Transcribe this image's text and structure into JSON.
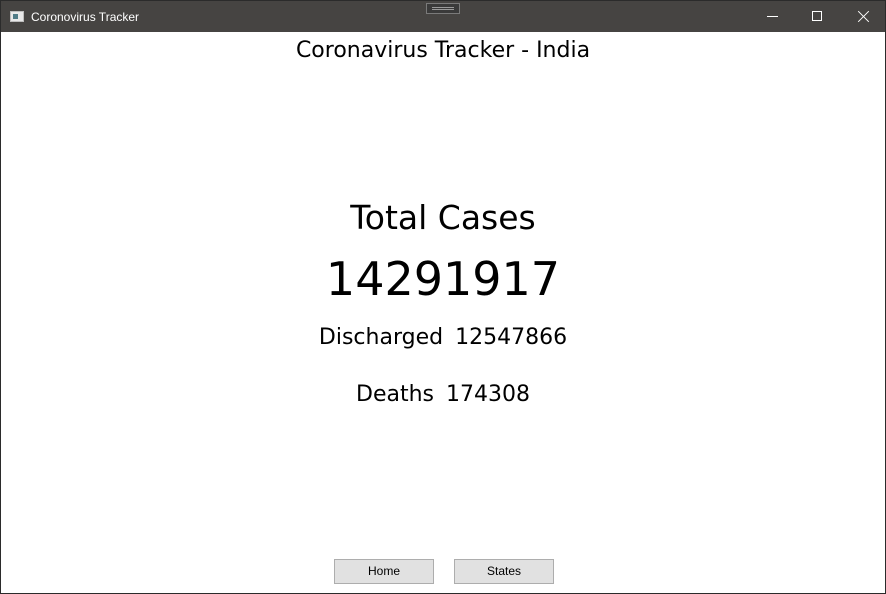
{
  "window": {
    "title": "Coronovirus Tracker"
  },
  "main": {
    "heading": "Coronavirus Tracker - India",
    "total_label": "Total Cases",
    "total_value": "14291917",
    "discharged_label": "Discharged",
    "discharged_value": "12547866",
    "deaths_label": "Deaths",
    "deaths_value": "174308"
  },
  "buttons": {
    "home": "Home",
    "states": "States"
  },
  "icons": {
    "app": "app-window-icon",
    "minimize": "minimize-icon",
    "maximize": "maximize-icon",
    "close": "close-icon"
  },
  "colors": {
    "titlebar": "#464442",
    "background": "#ffffff",
    "button": "#e1e1e1",
    "button_border": "#adadad"
  }
}
